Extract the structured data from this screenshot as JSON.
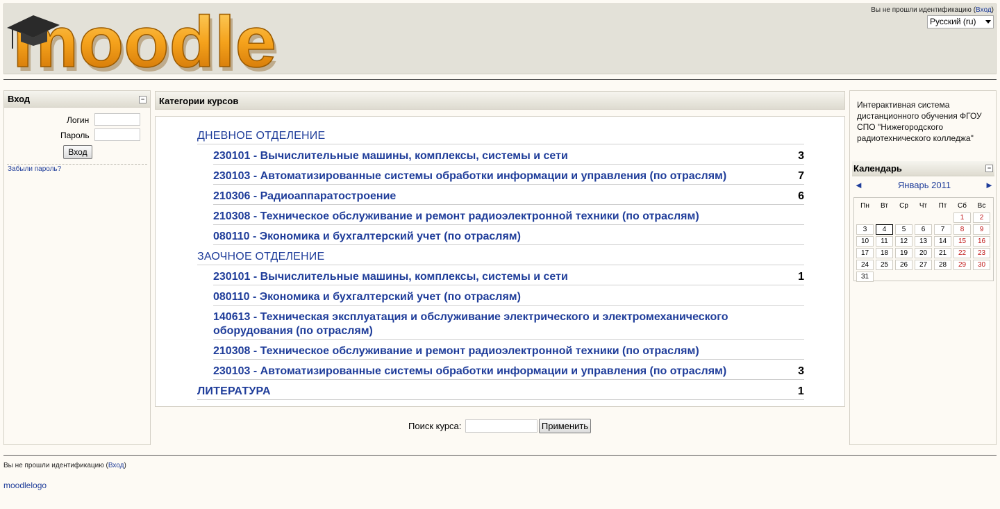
{
  "header": {
    "logo_text": "moodle",
    "login_prefix": "Вы не прошли идентификацию (",
    "login_link": "Вход",
    "login_suffix": ")",
    "language": "Русский (ru)"
  },
  "login_block": {
    "title": "Вход",
    "username_label": "Логин",
    "password_label": "Пароль",
    "submit_label": "Вход",
    "forgot_link": "Забыли пароль?"
  },
  "categories": {
    "title": "Категории курсов",
    "items": [
      {
        "label": "ДНЕВНОЕ ОТДЕЛЕНИЕ",
        "count": ""
      },
      {
        "label": "230101 - Вычислительные машины, комплексы, системы и сети",
        "count": "3"
      },
      {
        "label": "230103 - Автоматизированные системы обработки информации и управления (по отраслям)",
        "count": "7"
      },
      {
        "label": "210306 - Радиоаппаратостроение",
        "count": "6"
      },
      {
        "label": "210308 - Техническое обслуживание и ремонт радиоэлектронной техники (по отраслям)",
        "count": ""
      },
      {
        "label": "080110 - Экономика и бухгалтерский учет (по отраслям)",
        "count": ""
      },
      {
        "label": "ЗАОЧНОЕ ОТДЕЛЕНИЕ",
        "count": ""
      },
      {
        "label": "230101 - Вычислительные машины, комплексы, системы и сети",
        "count": "1"
      },
      {
        "label": "080110 - Экономика и бухгалтерский учет (по отраслям)",
        "count": ""
      },
      {
        "label": "140613 - Техническая эксплуатация и обслуживание электрического и электромеханического оборудования (по отраслям)",
        "count": ""
      },
      {
        "label": "210308 - Техническое обслуживание и ремонт радиоэлектронной техники (по отраслям)",
        "count": ""
      },
      {
        "label": "230103 - Автоматизированные системы обработки информации и управления (по отраслям)",
        "count": "3"
      },
      {
        "label": "ЛИТЕРАТУРА",
        "count": "1"
      }
    ]
  },
  "search": {
    "label": "Поиск курса:",
    "button": "Применить"
  },
  "info_block": {
    "text": "Интерактивная система дистанционного обучения ФГОУ СПО \"Нижегородского радиотехнического колледжа\""
  },
  "calendar": {
    "title": "Календарь",
    "month": "Январь 2011",
    "prev": "◄",
    "next": "►",
    "weekdays": [
      "Пн",
      "Вт",
      "Ср",
      "Чт",
      "Пт",
      "Сб",
      "Вс"
    ],
    "weeks": [
      [
        "",
        "",
        "",
        "",
        "",
        "1",
        "2"
      ],
      [
        "3",
        "4",
        "5",
        "6",
        "7",
        "8",
        "9"
      ],
      [
        "10",
        "11",
        "12",
        "13",
        "14",
        "15",
        "16"
      ],
      [
        "17",
        "18",
        "19",
        "20",
        "21",
        "22",
        "23"
      ],
      [
        "24",
        "25",
        "26",
        "27",
        "28",
        "29",
        "30"
      ],
      [
        "31",
        "",
        "",
        "",
        "",
        "",
        ""
      ]
    ],
    "today": "4"
  },
  "footer": {
    "login_prefix": "Вы не прошли идентификацию (",
    "login_link": "Вход",
    "login_suffix": ")",
    "logo_link": "moodlelogo"
  },
  "colors": {
    "link": "#1f3d9a",
    "header_bg": "#e3e1d8",
    "page_bg": "#fdfaf4",
    "logo_orange": "#f0a020",
    "weekend": "#c01818"
  }
}
